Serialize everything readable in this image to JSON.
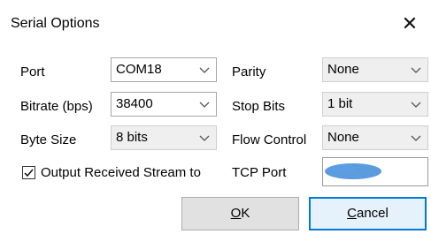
{
  "window": {
    "title": "Serial Options",
    "close_symbol": "✕"
  },
  "fields": {
    "port": {
      "label": "Port",
      "value": "COM18"
    },
    "bitrate": {
      "label": "Bitrate (bps)",
      "value": "38400"
    },
    "byte_size": {
      "label": "Byte Size",
      "value": "8 bits"
    },
    "parity": {
      "label": "Parity",
      "value": "None"
    },
    "stop_bits": {
      "label": "Stop Bits",
      "value": "1 bit"
    },
    "flow_control": {
      "label": "Flow Control",
      "value": "None"
    }
  },
  "output_stream": {
    "checkbox_label": "Output Received Stream to",
    "checked": true,
    "tcp_port_label": "TCP Port",
    "tcp_port_value_redacted": true,
    "redaction_color": "#4a90d9"
  },
  "buttons": {
    "ok": {
      "mnemonic": "O",
      "rest": "K"
    },
    "cancel": {
      "mnemonic": "C",
      "rest": "ancel"
    }
  },
  "icons": {
    "close": "close-icon",
    "dropdown": "chevron-down-icon",
    "check": "checkmark-icon"
  },
  "colors": {
    "focus_border": "#0078d7",
    "button_face": "#e1e1e1",
    "disabled_combo": "#efefef"
  }
}
